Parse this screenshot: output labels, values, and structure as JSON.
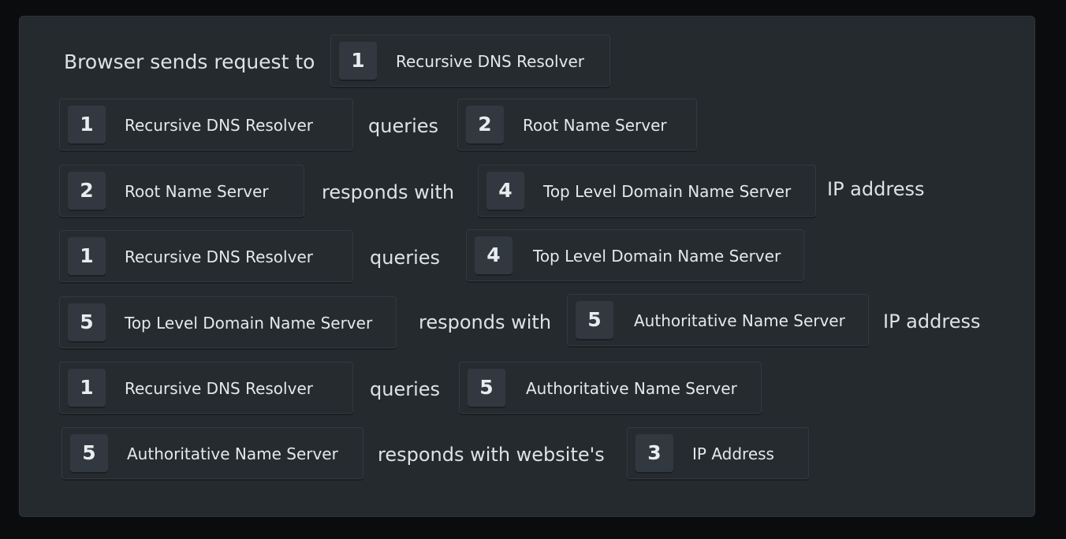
{
  "steps": [
    {
      "lead_text": "Browser sends request to",
      "target": {
        "num": "1",
        "label": "Recursive DNS Resolver"
      }
    },
    {
      "subject": {
        "num": "1",
        "label": "Recursive DNS Resolver"
      },
      "verb": "queries",
      "object": {
        "num": "2",
        "label": "Root Name Server"
      }
    },
    {
      "subject": {
        "num": "2",
        "label": "Root Name Server"
      },
      "verb": "responds with",
      "object": {
        "num": "4",
        "label": "Top Level Domain Name Server"
      },
      "suffix": "IP address"
    },
    {
      "subject": {
        "num": "1",
        "label": "Recursive DNS Resolver"
      },
      "verb": "queries",
      "object": {
        "num": "4",
        "label": "Top Level Domain Name Server"
      }
    },
    {
      "subject": {
        "num": "5",
        "label": "Top Level Domain Name Server"
      },
      "verb": "responds with",
      "object": {
        "num": "5",
        "label": "Authoritative Name Server"
      },
      "suffix": "IP address"
    },
    {
      "subject": {
        "num": "1",
        "label": "Recursive DNS Resolver"
      },
      "verb": "queries",
      "object": {
        "num": "5",
        "label": "Authoritative Name Server"
      }
    },
    {
      "subject": {
        "num": "5",
        "label": "Authoritative Name Server"
      },
      "verb": "responds with website's",
      "object": {
        "num": "3",
        "label": "IP Address"
      }
    }
  ]
}
